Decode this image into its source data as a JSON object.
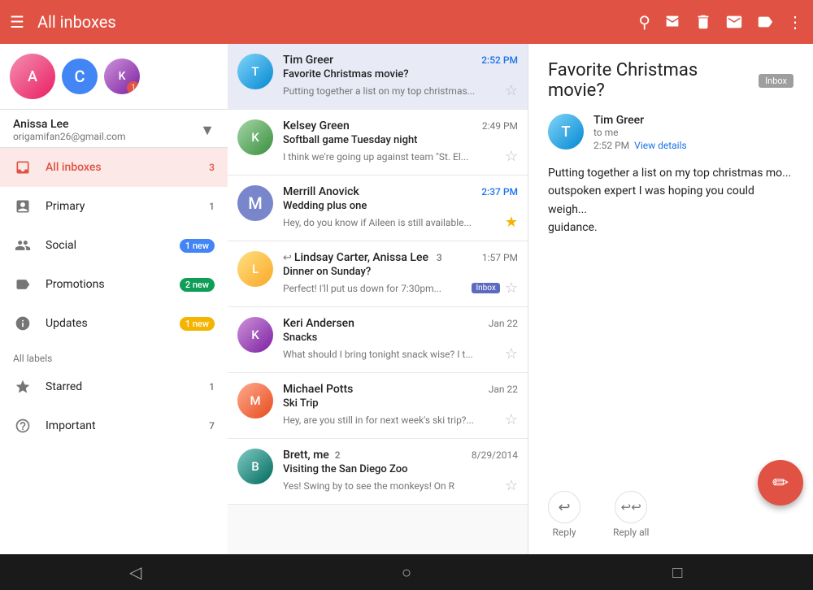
{
  "topbar": {
    "title": "All inboxes",
    "icons": [
      "menu",
      "search",
      "archive",
      "delete",
      "mail",
      "label",
      "more"
    ]
  },
  "sidebar": {
    "account": {
      "name": "Anissa Lee",
      "email": "origamifan26@gmail.com",
      "initials": "C"
    },
    "nav_items": [
      {
        "id": "all-inboxes",
        "label": "All inboxes",
        "badge": "3",
        "badge_type": "number",
        "active": true,
        "icon": "inbox"
      },
      {
        "id": "primary",
        "label": "Primary",
        "badge": "1",
        "badge_type": "number",
        "icon": "primary"
      },
      {
        "id": "social",
        "label": "Social",
        "badge": "1 new",
        "badge_type": "pill-blue",
        "icon": "social"
      },
      {
        "id": "promotions",
        "label": "Promotions",
        "badge": "2 new",
        "badge_type": "pill-green",
        "icon": "promotions"
      },
      {
        "id": "updates",
        "label": "Updates",
        "badge": "1 new",
        "badge_type": "pill-yellow",
        "icon": "updates"
      }
    ],
    "all_labels": "All labels",
    "label_items": [
      {
        "id": "starred",
        "label": "Starred",
        "badge": "1",
        "icon": "star"
      },
      {
        "id": "important",
        "label": "Important",
        "badge": "7",
        "icon": "label"
      }
    ]
  },
  "emails": [
    {
      "id": "1",
      "sender": "Tim Greer",
      "subject": "Favorite Christmas movie?",
      "preview": "Putting together a list on my top christmas...",
      "time": "2:52 PM",
      "time_unread": true,
      "starred": false,
      "selected": true,
      "avatar_class": "avatar-tim",
      "avatar_initial": "T",
      "has_inbox_badge": false,
      "has_reply_icon": false
    },
    {
      "id": "2",
      "sender": "Kelsey Green",
      "subject": "Softball game Tuesday night",
      "preview": "I think we're going up against team \"St. El...",
      "time": "2:49 PM",
      "time_unread": false,
      "starred": false,
      "selected": false,
      "avatar_class": "avatar-kelsey",
      "avatar_initial": "K",
      "has_inbox_badge": false,
      "has_reply_icon": false
    },
    {
      "id": "3",
      "sender": "Merrill Anovick",
      "subject": "Wedding plus one",
      "preview": "Hey, do you know if Aileen is still available...",
      "time": "2:37 PM",
      "time_unread": true,
      "starred": true,
      "selected": false,
      "avatar_class": "avatar-merrill",
      "avatar_initial": "M",
      "has_inbox_badge": false,
      "has_reply_icon": false
    },
    {
      "id": "4",
      "sender": "Lindsay Carter, Anissa Lee  3",
      "subject": "Dinner on Sunday?",
      "preview": "Perfect! I'll put us down for 7:30pm...",
      "time": "1:57 PM",
      "time_unread": false,
      "starred": false,
      "selected": false,
      "avatar_class": "avatar-lindsay",
      "avatar_initial": "L",
      "has_inbox_badge": true,
      "has_reply_icon": true
    },
    {
      "id": "5",
      "sender": "Keri Andersen",
      "subject": "Snacks",
      "preview": "What should I bring tonight snack wise? I t...",
      "time": "Jan 22",
      "time_unread": false,
      "starred": false,
      "selected": false,
      "avatar_class": "avatar-keri",
      "avatar_initial": "K",
      "has_inbox_badge": false,
      "has_reply_icon": false
    },
    {
      "id": "6",
      "sender": "Michael Potts",
      "subject": "Ski Trip",
      "preview": "Hey, are you still in for next week's ski trip?...",
      "time": "Jan 22",
      "time_unread": false,
      "starred": false,
      "selected": false,
      "avatar_class": "avatar-michael",
      "avatar_initial": "M",
      "has_inbox_badge": false,
      "has_reply_icon": false
    },
    {
      "id": "7",
      "sender": "Brett, me  2",
      "subject": "Visiting the San Diego Zoo",
      "preview": "Yes! Swing by to see the monkeys! On R",
      "time": "8/29/2014",
      "time_unread": false,
      "starred": false,
      "selected": false,
      "avatar_class": "avatar-brett",
      "avatar_initial": "B",
      "has_inbox_badge": false,
      "has_reply_icon": false
    }
  ],
  "email_detail": {
    "subject": "Favorite Christmas movie?",
    "label": "Inbox",
    "sender_name": "Tim Greer",
    "to": "to me",
    "time": "2:52 PM",
    "view_details": "View details",
    "body": "Putting together a list on my top christmas mo... outspoken expert I was hoping you could weigh... guidance.",
    "reply_label": "Reply",
    "reply_all_label": "Reply all"
  },
  "fab": {
    "icon": "✏"
  },
  "bottom_nav": {
    "back": "◁",
    "home": "○",
    "recent": "□"
  }
}
